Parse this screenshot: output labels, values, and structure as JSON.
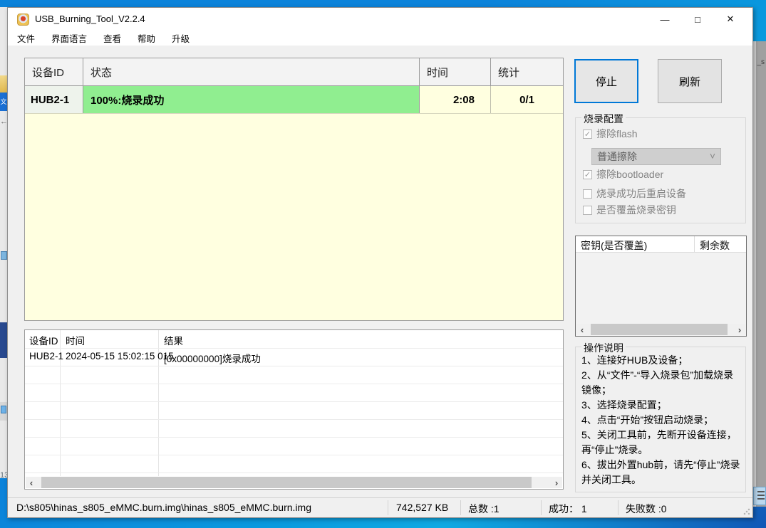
{
  "window": {
    "title": "USB_Burning_Tool_V2.2.4"
  },
  "menu": {
    "items": [
      {
        "label": "文件"
      },
      {
        "label": "界面语言"
      },
      {
        "label": "查看"
      },
      {
        "label": "帮助"
      },
      {
        "label": "升级"
      }
    ]
  },
  "device_table": {
    "columns": [
      "设备ID",
      "状态",
      "时间",
      "统计"
    ],
    "rows": [
      {
        "device_id": "HUB2-1",
        "status": "100%:烧录成功",
        "time": "2:08",
        "stats": "0/1"
      }
    ]
  },
  "actions": {
    "stop_label": "停止",
    "refresh_label": "刷新"
  },
  "burn_config": {
    "title": "烧录配置",
    "erase_flash": {
      "label": "擦除flash",
      "checked": true
    },
    "erase_mode": {
      "value": "普通擦除"
    },
    "erase_bootloader": {
      "label": "擦除bootloader",
      "checked": true
    },
    "reboot_after": {
      "label": "烧录成功后重启设备",
      "checked": false
    },
    "overwrite_key": {
      "label": "是否覆盖烧录密钥",
      "checked": false
    }
  },
  "key_table": {
    "columns": [
      "密钥(是否覆盖)",
      "剩余数"
    ],
    "rows": []
  },
  "instructions": {
    "title": "操作说明",
    "lines": [
      "1、连接好HUB及设备；",
      "2、从“文件”-“导入烧录包”加载烧录镜像；",
      "3、选择烧录配置；",
      "4、点击“开始”按钮启动烧录；",
      "5、关闭工具前，先断开设备连接，再“停止”烧录。",
      "6、拔出外置hub前，请先“停止”烧录并关闭工具。"
    ]
  },
  "log_table": {
    "columns": [
      "设备ID",
      "时间",
      "结果"
    ],
    "rows": [
      {
        "device_id": "HUB2-1",
        "time": "2024-05-15 15:02:15 015",
        "result": "[0x00000000]烧录成功"
      }
    ]
  },
  "status_bar": {
    "file_path": "D:\\s805\\hinas_s805_eMMC.burn.img\\hinas_s805_eMMC.burn.img",
    "file_size": "742,527 KB",
    "total": "总数 :1",
    "success": "成功： 1",
    "failed": "失败数 :0"
  },
  "background": {
    "left_strip": {
      "label_13": "13",
      "translate_icon_text": "文",
      "back_arrow": "←"
    },
    "right_strip": {
      "partial_text": "_s"
    }
  },
  "icons": {
    "minimize": "—",
    "maximize": "□",
    "close": "✕",
    "check": "✓",
    "chevron_down": "˅",
    "scroll_left": "‹",
    "scroll_right": "›"
  },
  "colors": {
    "accent_blue": "#0078d7",
    "success_green": "#90ee90",
    "table_cream": "#ffffe0",
    "desktop_blue": "#0c83da"
  }
}
